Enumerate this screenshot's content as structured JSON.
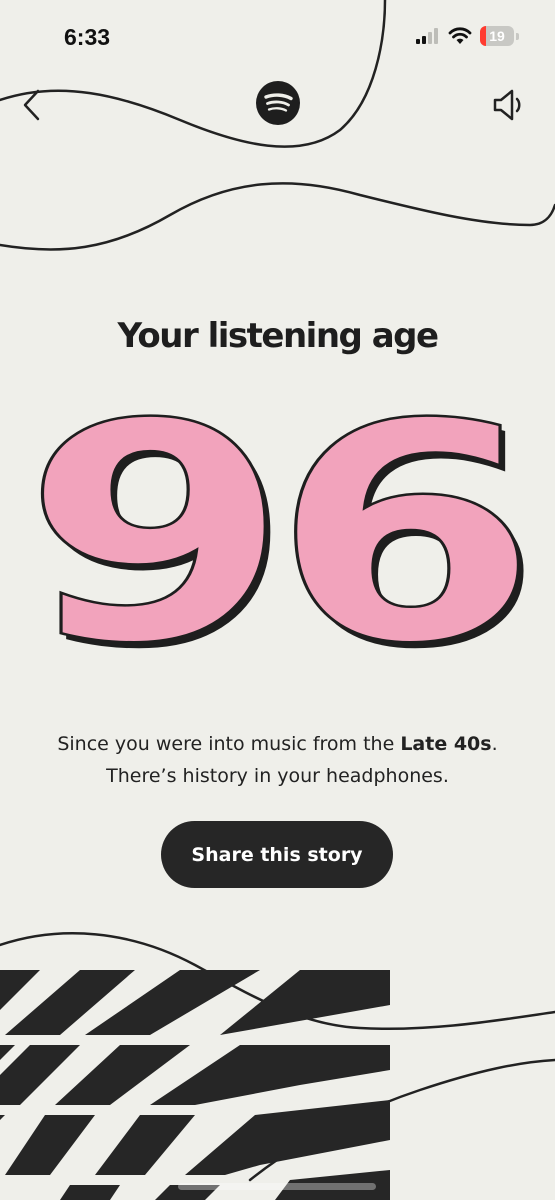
{
  "status_bar": {
    "time": "6:33",
    "battery_level": "19",
    "battery_fraction": 0.19,
    "battery_color": "#ff3b30",
    "icons": [
      "signal-icon",
      "wifi-icon",
      "battery-icon"
    ]
  },
  "nav": {
    "icons": [
      "back-chevron-icon",
      "spotify-logo-icon",
      "speaker-icon"
    ]
  },
  "story": {
    "headline": "Your listening age",
    "age": "96",
    "caption_line1_prefix": "Since you were into music from the ",
    "caption_line1_bold": "Late 40s",
    "caption_line1_suffix": ".",
    "caption_line2": "There’s history in your headphones.",
    "share_label": "Share this story"
  },
  "colors": {
    "background": "#efefea",
    "age_fill": "#f2a3bc",
    "ink": "#1e1e1e",
    "button": "#262626"
  }
}
